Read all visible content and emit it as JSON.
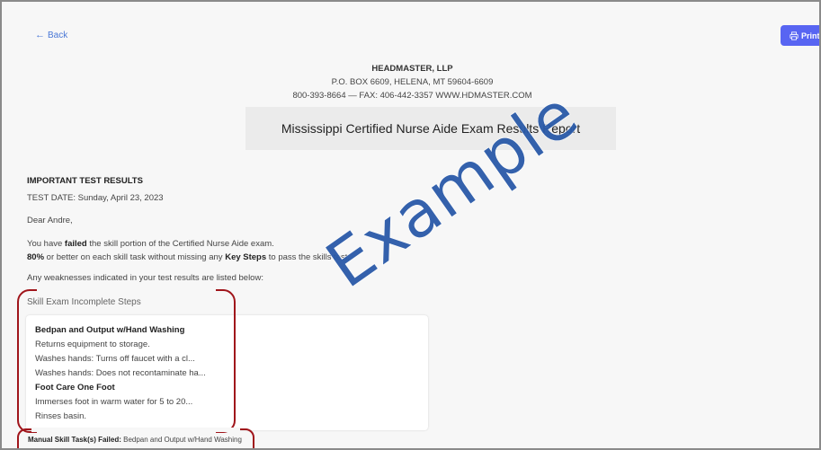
{
  "nav": {
    "back_label": "Back",
    "print_label": "Print"
  },
  "header": {
    "company": "HEADMASTER, LLP",
    "address": "P.O. BOX 6609, HELENA, MT 59604-6609",
    "contact": "800-393-8664 — FAX: 406-442-3357 WWW.HDMASTER.COM",
    "report_title": "Mississippi Certified Nurse Aide Exam Results Report"
  },
  "letter": {
    "heading": "IMPORTANT TEST RESULTS",
    "test_date": "TEST DATE: Sunday, April 23, 2023",
    "greeting": "Dear Andre,",
    "failed_prefix": "You have ",
    "failed_word": "failed",
    "failed_suffix": " the skill portion of the Certified Nurse Aide exam.",
    "pct_bold": "80%",
    "pct_middle": " or better on each skill task without missing any ",
    "pct_keysteps": "Key Steps",
    "pct_suffix": " to pass the skills test.",
    "weakness_note": "Any weaknesses indicated in your test results are listed below:"
  },
  "incomplete": {
    "section_title": "Skill Exam Incomplete Steps",
    "lines": [
      {
        "text": "Bedpan and Output w/Hand Washing",
        "kind": "task"
      },
      {
        "text": "Returns equipment to storage.",
        "kind": "step"
      },
      {
        "text": "Washes hands: Turns off faucet with a cl...",
        "kind": "step"
      },
      {
        "text": "Washes hands: Does not recontaminate ha...",
        "kind": "step"
      },
      {
        "text": "Foot Care One Foot",
        "kind": "task"
      },
      {
        "text": "Immerses foot in warm water for 5 to 20...",
        "kind": "step"
      },
      {
        "text": "Rinses basin.",
        "kind": "step"
      }
    ]
  },
  "manual": {
    "label": "Manual Skill Task(s) Failed:",
    "value": " Bedpan and Output w/Hand Washing"
  },
  "watermark": {
    "text": "Example",
    "color": "#2a5aa8"
  },
  "colors": {
    "accent": "#5865f2",
    "link": "#4a78d6",
    "annotation": "#a0151b"
  }
}
